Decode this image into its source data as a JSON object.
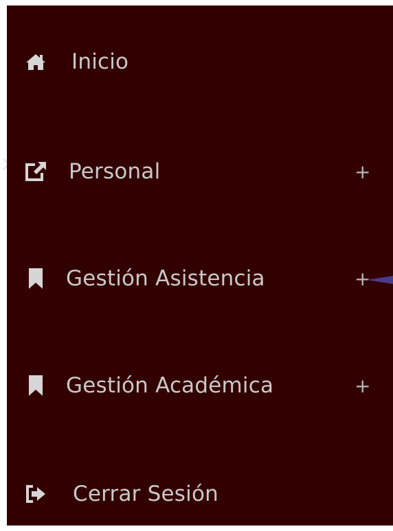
{
  "sidebar": {
    "items": [
      {
        "label": "Inicio",
        "icon": "home-icon",
        "expandable": false
      },
      {
        "label": "Personal",
        "icon": "external-link-icon",
        "expandable": true,
        "expand_symbol": "+"
      },
      {
        "label": "Gestión Asistencia",
        "icon": "bookmark-icon",
        "expandable": true,
        "expand_symbol": "+"
      },
      {
        "label": "Gestión Académica",
        "icon": "bookmark-icon",
        "expandable": true,
        "expand_symbol": "+"
      },
      {
        "label": "Cerrar Sesión",
        "icon": "logout-icon",
        "expandable": false
      }
    ]
  },
  "colors": {
    "sidebar_bg": "#330000",
    "text": "#c9c9c9",
    "icon": "#d6d6d6",
    "accent": "#4a3a8a"
  }
}
